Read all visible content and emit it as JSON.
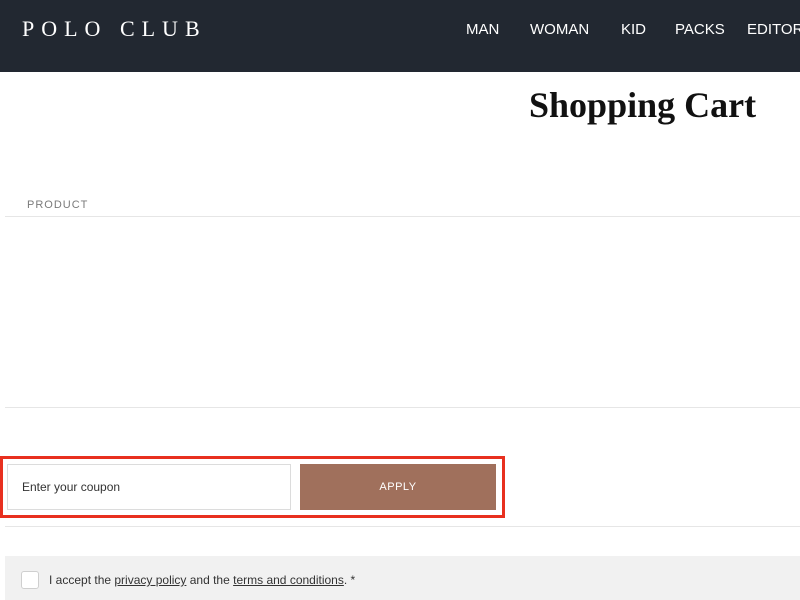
{
  "brand": {
    "logo_text": "POLO CLUB"
  },
  "nav": {
    "items": [
      {
        "label": "MAN"
      },
      {
        "label": "WOMAN"
      },
      {
        "label": "KID"
      },
      {
        "label": "PACKS"
      },
      {
        "label": "EDITOR"
      }
    ]
  },
  "page": {
    "title": "Shopping Cart"
  },
  "cart": {
    "product_column_header": "PRODUCT"
  },
  "coupon": {
    "placeholder": "Enter your coupon",
    "value": "",
    "apply_label": "APPLY"
  },
  "consent": {
    "text_before": "I accept the ",
    "privacy_link": "privacy policy",
    "text_middle": " and the ",
    "terms_link": "terms and conditions",
    "text_after": ".",
    "required_marker": " *"
  },
  "colors": {
    "header_bg": "#222831",
    "apply_button_bg": "#a0705c",
    "highlight_border": "#e8301f",
    "consent_bg": "#f1f1f1"
  }
}
